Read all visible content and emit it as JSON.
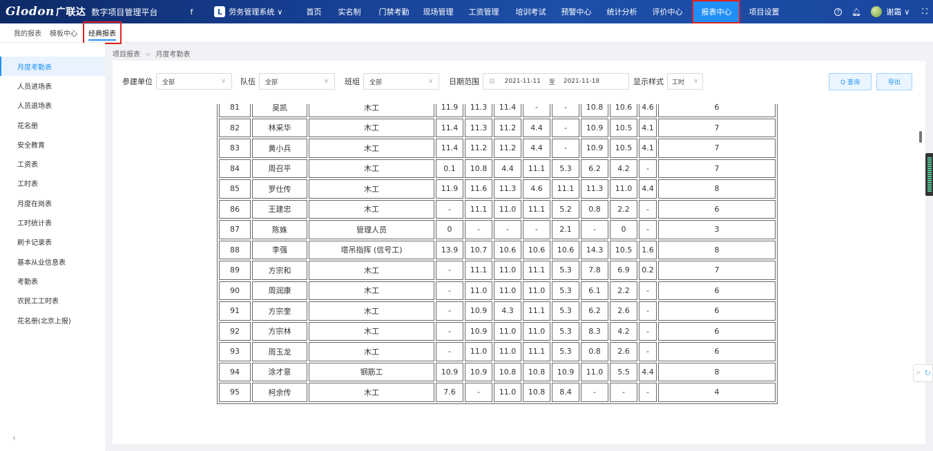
{
  "topbar": {
    "logo": "Glodon",
    "logo_cn": "广联达",
    "platform": "数字项目管理平台",
    "switch_icon": "org-switch-icon",
    "system": {
      "badge": "L",
      "label": "劳务管理系统",
      "chevron": "∨"
    },
    "nav": [
      "首页",
      "实名制",
      "门禁考勤",
      "现场管理",
      "工资管理",
      "培训考试",
      "预警中心",
      "统计分析",
      "评价中心",
      "报表中心",
      "项目设置"
    ],
    "active_nav": "报表中心",
    "help": "?",
    "bell": "bell-icon",
    "user": "谢霜",
    "user_chevron": "∨",
    "fullscreen": "⛶"
  },
  "subtabs": [
    "我的报表",
    "模板中心",
    "经典报表"
  ],
  "active_subtab": "经典报表",
  "sidebar": {
    "items": [
      "月度考勤表",
      "人员进场表",
      "人员退场表",
      "花名册",
      "安全教育",
      "工资表",
      "工时表",
      "月度在岗表",
      "工时统计表",
      "刷卡记录表",
      "基本从业信息表",
      "考勤表",
      "农民工工时表",
      "花名册(北京上报)"
    ],
    "active": "月度考勤表",
    "collapse": "‹"
  },
  "breadcrumb": {
    "root": "项目报表",
    "separator": ">",
    "current": "月度考勤表"
  },
  "filters": {
    "unit_label": "参建单位",
    "unit_value": "全部",
    "team_label": "队伍",
    "team_value": "全部",
    "group_label": "班组",
    "group_value": "全部",
    "date_label": "日期范围",
    "date_start": "2021-11-11",
    "date_to": "至",
    "date_end": "2021-11-18",
    "style_label": "显示样式",
    "style_value": "工时",
    "chevron": "∨"
  },
  "buttons": {
    "query": "Q 查询",
    "export": "导出"
  },
  "table": {
    "rows": [
      [
        "81",
        "吴凯",
        "木工",
        "11.9",
        "11.3",
        "11.4",
        "-",
        "-",
        "10.8",
        "10.6",
        "4.6",
        "6"
      ],
      [
        "82",
        "林采华",
        "木工",
        "11.4",
        "11.3",
        "11.2",
        "4.4",
        "-",
        "10.9",
        "10.5",
        "4.1",
        "7"
      ],
      [
        "83",
        "黄小兵",
        "木工",
        "11.4",
        "11.2",
        "11.2",
        "4.4",
        "-",
        "10.9",
        "10.5",
        "4.1",
        "7"
      ],
      [
        "84",
        "周召平",
        "木工",
        "0.1",
        "10.8",
        "4.4",
        "11.1",
        "5.3",
        "6.2",
        "4.2",
        "-",
        "7"
      ],
      [
        "85",
        "罗仕传",
        "木工",
        "11.9",
        "11.6",
        "11.3",
        "4.6",
        "11.1",
        "11.3",
        "11.0",
        "4.4",
        "8"
      ],
      [
        "86",
        "王建忠",
        "木工",
        "-",
        "11.1",
        "11.0",
        "11.1",
        "5.2",
        "0.8",
        "2.2",
        "-",
        "6"
      ],
      [
        "87",
        "陈姝",
        "管理人员",
        "0",
        "-",
        "-",
        "-",
        "2.1",
        "-",
        "0",
        "-",
        "3"
      ],
      [
        "88",
        "李强",
        "塔吊指挥 (信号工)",
        "13.9",
        "10.7",
        "10.6",
        "10.6",
        "10.6",
        "14.3",
        "10.5",
        "1.6",
        "8"
      ],
      [
        "89",
        "方宗和",
        "木工",
        "-",
        "11.1",
        "11.0",
        "11.1",
        "5.3",
        "7.8",
        "6.9",
        "0.2",
        "7"
      ],
      [
        "90",
        "周润康",
        "木工",
        "-",
        "11.0",
        "11.0",
        "11.0",
        "5.3",
        "6.1",
        "2.2",
        "-",
        "6"
      ],
      [
        "91",
        "方宗奎",
        "木工",
        "-",
        "10.9",
        "4.3",
        "11.1",
        "5.3",
        "6.2",
        "2.6",
        "-",
        "6"
      ],
      [
        "92",
        "方宗林",
        "木工",
        "-",
        "10.9",
        "11.0",
        "11.0",
        "5.3",
        "8.3",
        "4.2",
        "-",
        "6"
      ],
      [
        "93",
        "周玉龙",
        "木工",
        "-",
        "11.0",
        "11.0",
        "11.1",
        "5.3",
        "0.8",
        "2.6",
        "-",
        "6"
      ],
      [
        "94",
        "涂才意",
        "钢筋工",
        "10.9",
        "10.9",
        "10.8",
        "10.8",
        "10.9",
        "11.0",
        "5.5",
        "4.4",
        "8"
      ],
      [
        "95",
        "柯余传",
        "木工",
        "7.6",
        "-",
        "11.0",
        "10.8",
        "8.4",
        "-",
        "-",
        "-",
        "4"
      ]
    ]
  },
  "float_widget": {
    "left": ">",
    "icon": "headset-icon"
  }
}
